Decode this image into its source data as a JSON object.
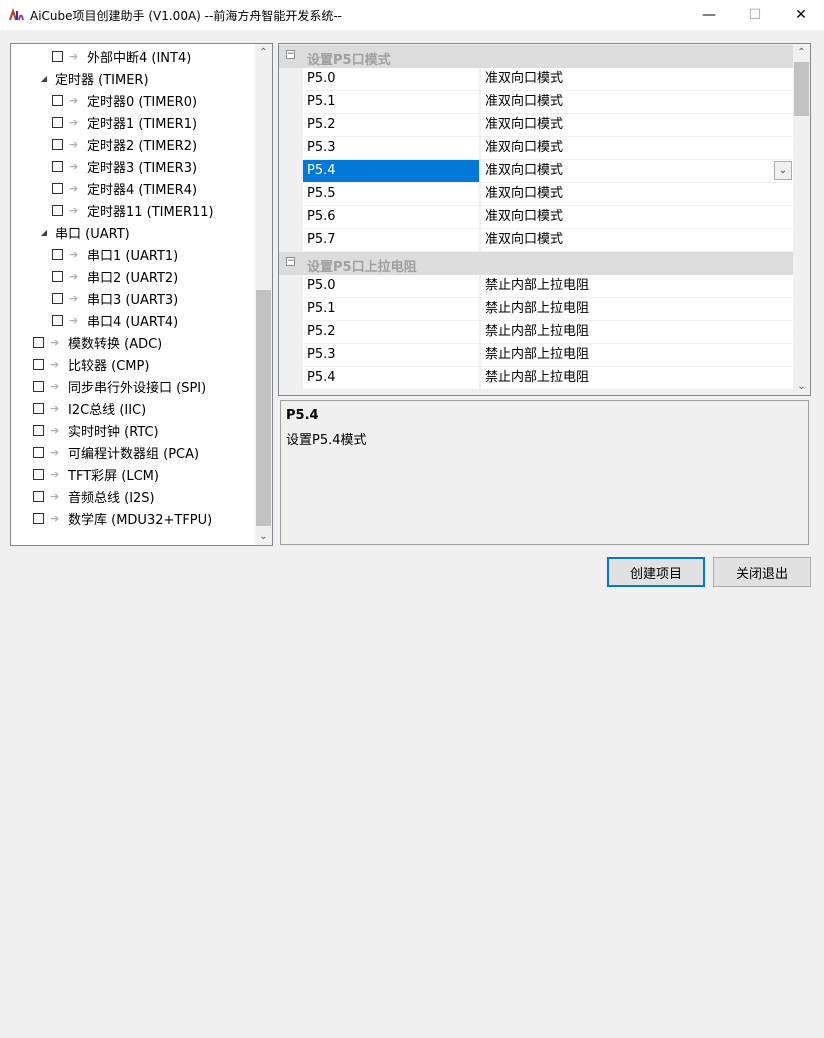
{
  "window": {
    "title": "AiCube项目创建助手 (V1.00A) --前海方舟智能开发系统--",
    "min_glyph": "—",
    "max_glyph": "☐",
    "close_glyph": "✕"
  },
  "tree": {
    "items": [
      {
        "label": "外部中断4 (INT4)",
        "level": 2
      },
      {
        "label": "定时器 (TIMER)",
        "level": 1,
        "expander": "◢"
      },
      {
        "label": "定时器0 (TIMER0)",
        "level": 2
      },
      {
        "label": "定时器1 (TIMER1)",
        "level": 2
      },
      {
        "label": "定时器2 (TIMER2)",
        "level": 2
      },
      {
        "label": "定时器3 (TIMER3)",
        "level": 2
      },
      {
        "label": "定时器4 (TIMER4)",
        "level": 2
      },
      {
        "label": "定时器11 (TIMER11)",
        "level": 2
      },
      {
        "label": "串口 (UART)",
        "level": 1,
        "expander": "◢"
      },
      {
        "label": "串口1 (UART1)",
        "level": 2
      },
      {
        "label": "串口2 (UART2)",
        "level": 2
      },
      {
        "label": "串口3 (UART3)",
        "level": 2
      },
      {
        "label": "串口4 (UART4)",
        "level": 2
      },
      {
        "label": "模数转换 (ADC)",
        "level": 0
      },
      {
        "label": "比较器 (CMP)",
        "level": 0
      },
      {
        "label": "同步串行外设接口 (SPI)",
        "level": 0
      },
      {
        "label": "I2C总线 (IIC)",
        "level": 0
      },
      {
        "label": "实时时钟 (RTC)",
        "level": 0
      },
      {
        "label": "可编程计数器组 (PCA)",
        "level": 0
      },
      {
        "label": "TFT彩屏 (LCM)",
        "level": 0
      },
      {
        "label": "音频总线 (I2S)",
        "level": 0
      },
      {
        "label": "数学库 (MDU32+TFPU)",
        "level": 0
      }
    ],
    "scroll_up": "⌃",
    "scroll_down": "⌄"
  },
  "grid": {
    "categories": [
      {
        "label": "设置P5口模式",
        "toggle": "−",
        "rows": [
          {
            "name": "P5.0",
            "value": "准双向口模式"
          },
          {
            "name": "P5.1",
            "value": "准双向口模式"
          },
          {
            "name": "P5.2",
            "value": "准双向口模式"
          },
          {
            "name": "P5.3",
            "value": "准双向口模式"
          },
          {
            "name": "P5.4",
            "value": "准双向口模式",
            "selected": true
          },
          {
            "name": "P5.5",
            "value": "准双向口模式"
          },
          {
            "name": "P5.6",
            "value": "准双向口模式"
          },
          {
            "name": "P5.7",
            "value": "准双向口模式"
          }
        ]
      },
      {
        "label": "设置P5口上拉电阻",
        "toggle": "−",
        "rows": [
          {
            "name": "P5.0",
            "value": "禁止内部上拉电阻"
          },
          {
            "name": "P5.1",
            "value": "禁止内部上拉电阻"
          },
          {
            "name": "P5.2",
            "value": "禁止内部上拉电阻"
          },
          {
            "name": "P5.3",
            "value": "禁止内部上拉电阻"
          },
          {
            "name": "P5.4",
            "value": "禁止内部上拉电阻"
          }
        ]
      }
    ],
    "dropdown_glyph": "⌄",
    "scroll_up": "⌃",
    "scroll_down": "⌄"
  },
  "description": {
    "title": "P5.4",
    "text": "设置P5.4模式"
  },
  "buttons": {
    "create": "创建项目",
    "exit": "关闭退出"
  }
}
